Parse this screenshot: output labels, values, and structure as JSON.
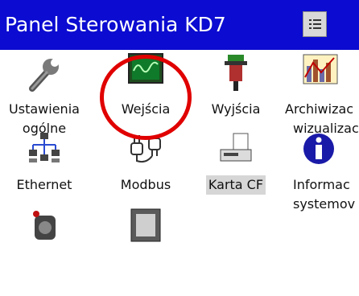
{
  "window": {
    "title": "Panel Sterowania KD7"
  },
  "menu_button": {
    "icon": "list-menu-icon"
  },
  "items": [
    {
      "label": [
        "Ustawienia",
        "ogólne"
      ],
      "icon": "wrench-icon"
    },
    {
      "label": [
        "Wejścia"
      ],
      "icon": "oscilloscope-icon"
    },
    {
      "label": [
        "Wyjścia"
      ],
      "icon": "output-connector-icon"
    },
    {
      "label": [
        "Archiwizac",
        "wizualizac"
      ],
      "icon": "bar-chart-icon"
    },
    {
      "label": [
        "Ethernet"
      ],
      "icon": "network-computers-icon"
    },
    {
      "label": [
        "Modbus"
      ],
      "icon": "modbus-connector-icon"
    },
    {
      "label": [
        "Karta CF"
      ],
      "icon": "cf-card-icon",
      "selected": true
    },
    {
      "label": [
        "Informac",
        "systemov"
      ],
      "icon": "info-icon"
    },
    {
      "label": [],
      "icon": "camera-device-icon"
    },
    {
      "label": [],
      "icon": "monitor-frame-icon"
    }
  ],
  "colors": {
    "titlebar": "#0b0bd1",
    "highlight_ring": "#e00000"
  }
}
